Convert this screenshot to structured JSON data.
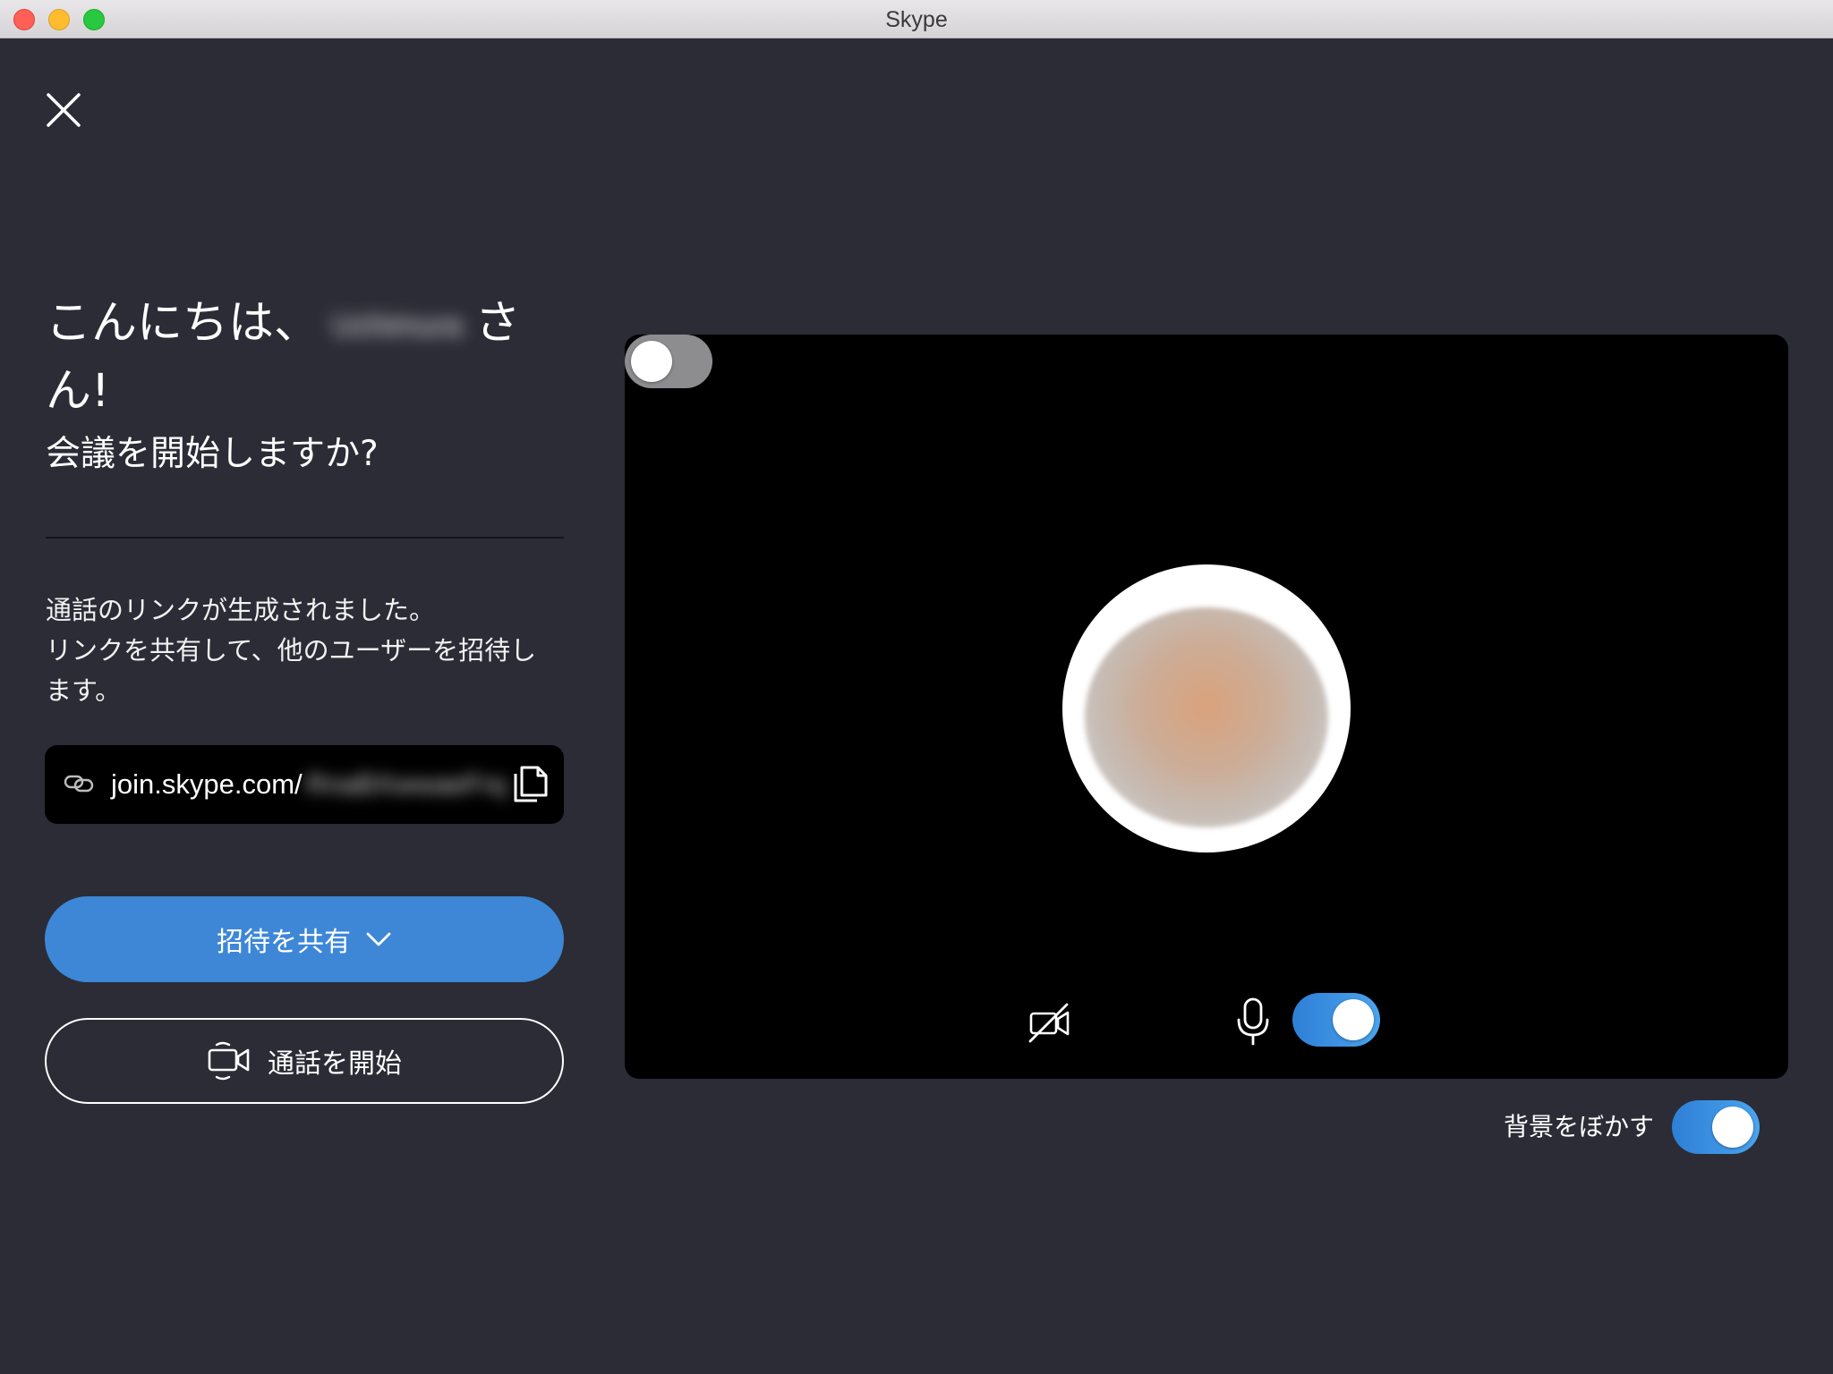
{
  "window": {
    "title": "Skype"
  },
  "header": {
    "close_icon": "close-icon"
  },
  "greeting": {
    "hello": "こんにちは、",
    "name": "Uchimura",
    "honorific_1": "さ",
    "honorific_2": "ん!"
  },
  "subheading": "会議を開始しますか?",
  "description": {
    "line1": "通話のリンクが生成されました。",
    "line2": "リンクを共有して、他のユーザーを招待し",
    "line3": "ます。"
  },
  "link": {
    "prefix": "join.skype.com/",
    "code": "RnaBXwwaeFrq",
    "link_icon": "link-icon",
    "copy_icon": "copy-icon"
  },
  "buttons": {
    "share_invite": "招待を共有",
    "share_icon": "chevron-down-icon",
    "start_call": "通話を開始",
    "start_icon": "video-call-icon"
  },
  "preview": {
    "camera_enabled": false,
    "microphone_enabled": true,
    "camera_icon": "camera-off-icon",
    "mic_icon": "microphone-icon"
  },
  "background_blur": {
    "label": "背景をぼかす",
    "enabled": true
  },
  "colors": {
    "background": "#2b2c36",
    "accent": "#3d87d6",
    "panel": "#000000",
    "toggle_off": "#8d8d90"
  }
}
